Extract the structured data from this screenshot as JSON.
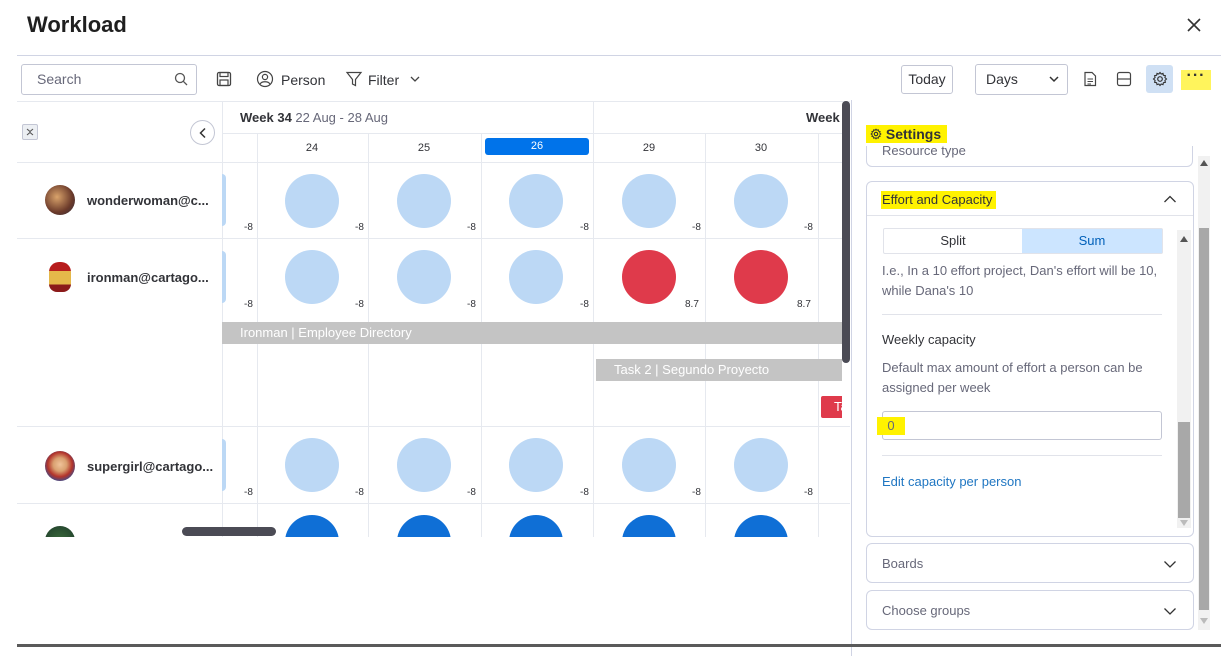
{
  "window": {
    "title": "Workload"
  },
  "toolbar": {
    "search_placeholder": "Search",
    "person_label": "Person",
    "filter_label": "Filter",
    "today_label": "Today",
    "view_value": "Days",
    "more_label": "···"
  },
  "timeline": {
    "week_label": "Week 34",
    "week_range": "22 Aug - 28 Aug",
    "next_week_label": "Week",
    "days": [
      "24",
      "25",
      "26",
      "29",
      "30"
    ],
    "selected_day": "26"
  },
  "people": [
    {
      "name": "wonderwoman@c...",
      "values": [
        "-8",
        "-8",
        "-8",
        "-8",
        "-8",
        "-8"
      ]
    },
    {
      "name": "ironman@cartago...",
      "values": [
        "-8",
        "-8",
        "-8",
        "-8",
        "8.7",
        "8.7"
      ]
    },
    {
      "name": "supergirl@cartago...",
      "values": [
        "-8",
        "-8",
        "-8",
        "-8",
        "-8",
        "-8"
      ]
    }
  ],
  "tasks": {
    "bar1": "Ironman | Employee Directory",
    "bar2": "Task 2 | Segundo Proyecto",
    "bar3": "Tas"
  },
  "settings": {
    "title": "Settings",
    "resource_type_label": "Resource type",
    "effort_section": "Effort and Capacity",
    "split_label": "Split",
    "sum_label": "Sum",
    "sum_description": "I.e., In a 10 effort project, Dan's effort will be 10, while Dana's 10",
    "weekly_capacity_title": "Weekly capacity",
    "weekly_capacity_desc": "Default max amount of effort a person can be assigned per week",
    "capacity_value": "0",
    "edit_capacity_link": "Edit capacity per person",
    "boards_label": "Boards",
    "choose_groups_label": "Choose groups"
  },
  "colors": {
    "accent": "#0073ea",
    "capacity_light": "#bcd8f5",
    "overload": "#df3a4b",
    "highlight": "#fff200"
  }
}
